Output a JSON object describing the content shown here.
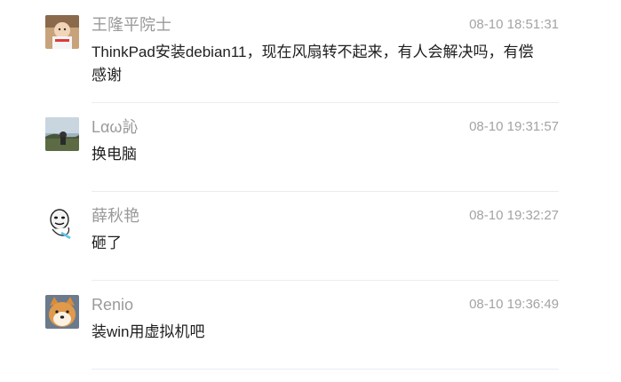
{
  "messages": [
    {
      "avatar_icon": "avatar-child-photo",
      "name": "王隆平院士",
      "time": "08-10 18:51:31",
      "text": "ThinkPad安装debian11，现在风扇转不起来，有人会解决吗，有偿 感谢"
    },
    {
      "avatar_icon": "avatar-landscape-photo",
      "name": "Lαω訫",
      "time": "08-10 19:31:57",
      "text": "换电脑"
    },
    {
      "avatar_icon": "avatar-meme-face",
      "name": "薛秋艳",
      "time": "08-10 19:32:27",
      "text": "砸了"
    },
    {
      "avatar_icon": "avatar-shiba-dog",
      "name": "Renio",
      "time": "08-10 19:36:49",
      "text": "装win用虚拟机吧"
    }
  ]
}
